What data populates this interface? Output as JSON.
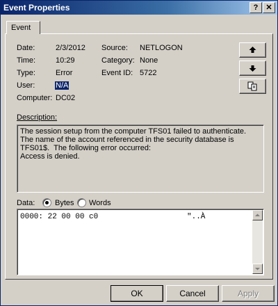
{
  "window": {
    "title": "Event Properties",
    "help_glyph": "?",
    "close_glyph": "✕"
  },
  "tabs": [
    {
      "label": "Event"
    }
  ],
  "event": {
    "date_label": "Date:",
    "date": "2/3/2012",
    "time_label": "Time:",
    "time": "10:29",
    "type_label": "Type:",
    "type": "Error",
    "user_label": "User:",
    "user": "N/A",
    "computer_label": "Computer:",
    "computer": "DC02",
    "source_label": "Source:",
    "source": "NETLOGON",
    "category_label": "Category:",
    "category": "None",
    "event_id_label": "Event ID:",
    "event_id": "5722"
  },
  "description": {
    "label": "Description:",
    "text": "The session setup from the computer TFS01 failed to authenticate. The name of the account referenced in the security database is TFS01$.  The following error occurred:\nAccess is denied."
  },
  "data": {
    "label": "Data:",
    "format_options": [
      "Bytes",
      "Words"
    ],
    "selected_format": "Bytes",
    "hex_line": "0000: 22 00 00 c0",
    "ascii_line": "\"..À"
  },
  "buttons": {
    "ok": "OK",
    "cancel": "Cancel",
    "apply": "Apply"
  },
  "icons": {
    "up": "arrow-up-icon",
    "down": "arrow-down-icon",
    "copy": "copy-icon"
  }
}
